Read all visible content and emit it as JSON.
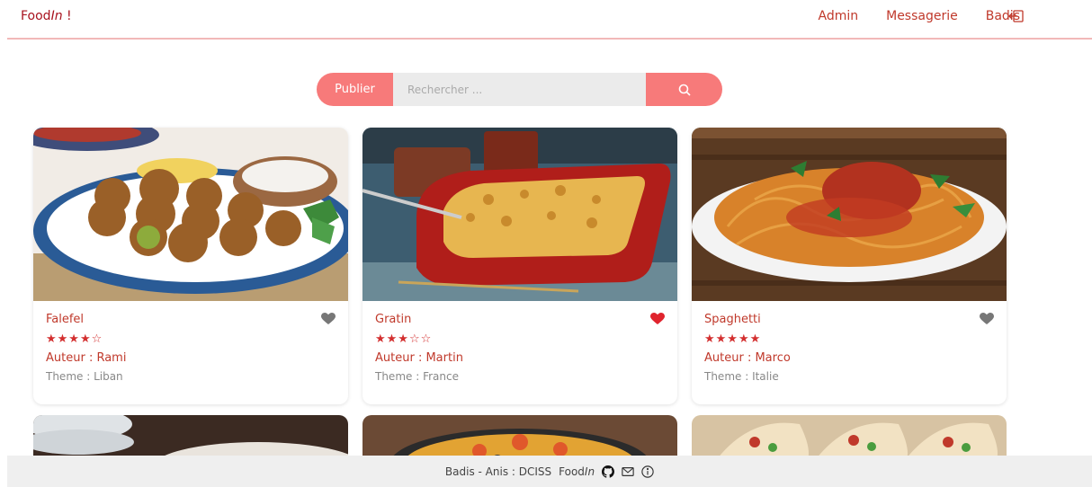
{
  "navbar": {
    "brand": "Food",
    "brand_italic": "In",
    "brand_suffix": " !",
    "links": [
      "Admin",
      "Messagerie",
      "Badis"
    ]
  },
  "search": {
    "publish_label": "Publier",
    "placeholder": "Rechercher ..."
  },
  "recipes": [
    {
      "title": "Falefel",
      "stars": "★★★★☆",
      "rating": 4,
      "favorite": false,
      "author": "Auteur : Rami",
      "theme": "Theme : Liban"
    },
    {
      "title": "Gratin",
      "stars": "★★★☆☆",
      "rating": 3,
      "favorite": true,
      "author": "Auteur : Martin",
      "theme": "Theme : France"
    },
    {
      "title": "Spaghetti",
      "stars": "★★★★★",
      "rating": 5,
      "favorite": false,
      "author": "Auteur : Marco",
      "theme": "Theme : Italie"
    }
  ],
  "footer": {
    "text": "Badis - Anis : DCISS",
    "brand": "Food",
    "brand_italic": "In"
  },
  "colors": {
    "accent": "#f77a7a",
    "brand": "#a8121e",
    "text_red": "#c0392b",
    "heart_active": "#e0242e",
    "heart_inactive": "#777777"
  }
}
